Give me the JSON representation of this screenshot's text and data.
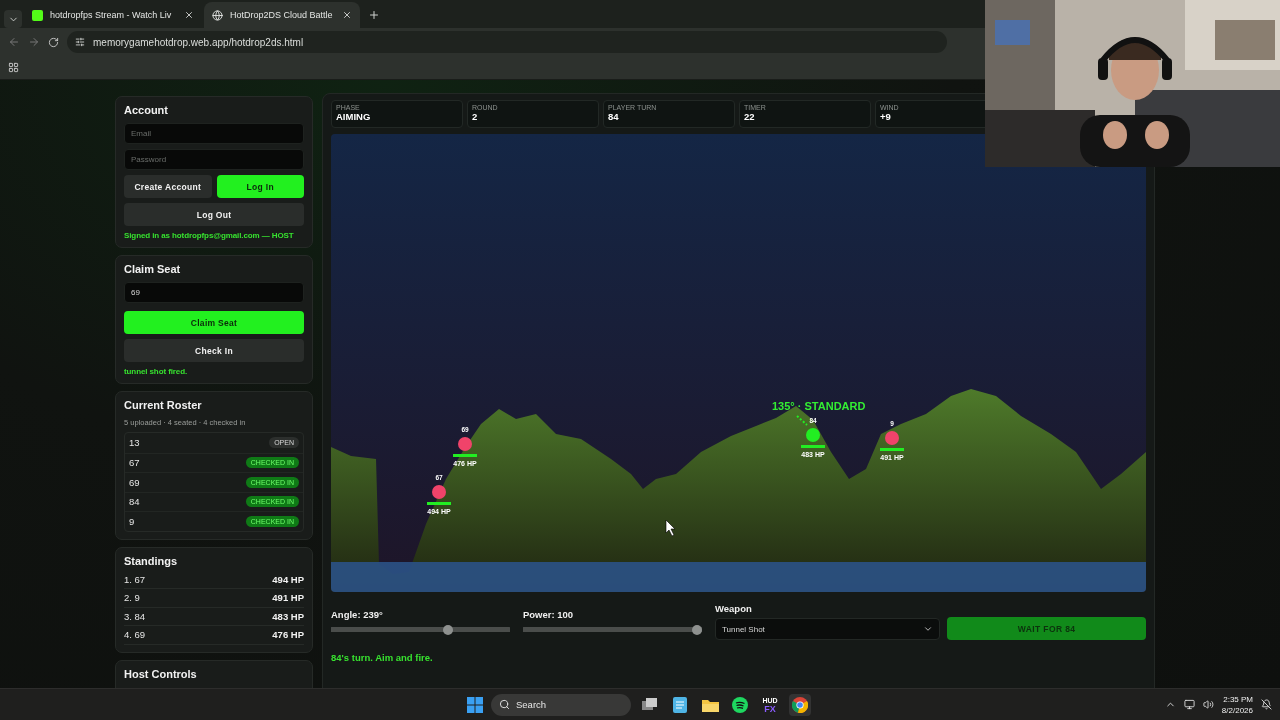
{
  "browser": {
    "tabs": [
      {
        "title": "hotdropfps Stream - Watch Liv",
        "selected": false
      },
      {
        "title": "HotDrop2DS Cloud Battle",
        "selected": true
      }
    ],
    "address": "memorygamehotdrop.web.app/hotdrop2ds.html"
  },
  "account": {
    "title": "Account",
    "email_placeholder": "Email",
    "password_placeholder": "Password",
    "buttons": [
      {
        "label": "Create Account",
        "kind": "secondary"
      },
      {
        "label": "Log In",
        "kind": "primary"
      }
    ],
    "logout": "Log Out",
    "status": "Signed in as hotdropfps@gmail.com — HOST"
  },
  "claim_seat": {
    "title": "Claim Seat",
    "value": "69",
    "buttons": [
      {
        "label": "Claim Seat",
        "kind": "primary"
      },
      {
        "label": "Check In",
        "kind": "secondary"
      }
    ],
    "message": "tunnel shot fired."
  },
  "roster": {
    "title": "Current Roster",
    "summary": "5 uploaded · 4 seated · 4 checked in",
    "rows": [
      {
        "seat": "13",
        "status": "OPEN",
        "kind": "open"
      },
      {
        "seat": "67",
        "status": "CHECKED IN",
        "kind": "checked"
      },
      {
        "seat": "69",
        "status": "CHECKED IN",
        "kind": "checked"
      },
      {
        "seat": "84",
        "status": "CHECKED IN",
        "kind": "checked"
      },
      {
        "seat": "9",
        "status": "CHECKED IN",
        "kind": "checked"
      }
    ]
  },
  "standings": {
    "title": "Standings",
    "rows": [
      {
        "rank": "1. 67",
        "hp": "494 HP"
      },
      {
        "rank": "2. 9",
        "hp": "491 HP"
      },
      {
        "rank": "3. 84",
        "hp": "483 HP"
      },
      {
        "rank": "4. 69",
        "hp": "476 HP"
      }
    ]
  },
  "host_controls": {
    "title": "Host Controls"
  },
  "stats": [
    {
      "label": "PHASE",
      "value": "AIMING"
    },
    {
      "label": "ROUND",
      "value": "2"
    },
    {
      "label": "PLAYER TURN",
      "value": "84"
    },
    {
      "label": "TIMER",
      "value": "22"
    },
    {
      "label": "WIND",
      "value": "+9"
    }
  ],
  "battlefield": {
    "aim_label": "135° · STANDARD",
    "tanks": [
      {
        "name": "69",
        "hp": "476 HP",
        "color": "#f0436a"
      },
      {
        "name": "67",
        "hp": "494 HP",
        "color": "#f0436a"
      },
      {
        "name": "84",
        "hp": "483 HP",
        "color": "#22ee22"
      },
      {
        "name": "9",
        "hp": "491 HP",
        "color": "#f0436a"
      }
    ]
  },
  "controls": {
    "angle": {
      "label": "Angle: 239°",
      "level": 0.66
    },
    "power": {
      "label": "Power: 100",
      "level": 1
    },
    "weapon": {
      "label": "Weapon",
      "value": "Tunnel Shot"
    },
    "fire_button": "WAIT FOR 84",
    "status": "84's turn. Aim and fire."
  },
  "taskbar": {
    "search": "Search",
    "apps": [
      {
        "kind": "taskview"
      },
      {
        "kind": "notepad"
      },
      {
        "kind": "folder"
      },
      {
        "kind": "spotify"
      },
      {
        "kind": "hudfx",
        "logo": [
          "HUD",
          "FX"
        ]
      },
      {
        "kind": "chrome"
      }
    ],
    "time": "2:35 PM",
    "date": "8/2/2026"
  }
}
